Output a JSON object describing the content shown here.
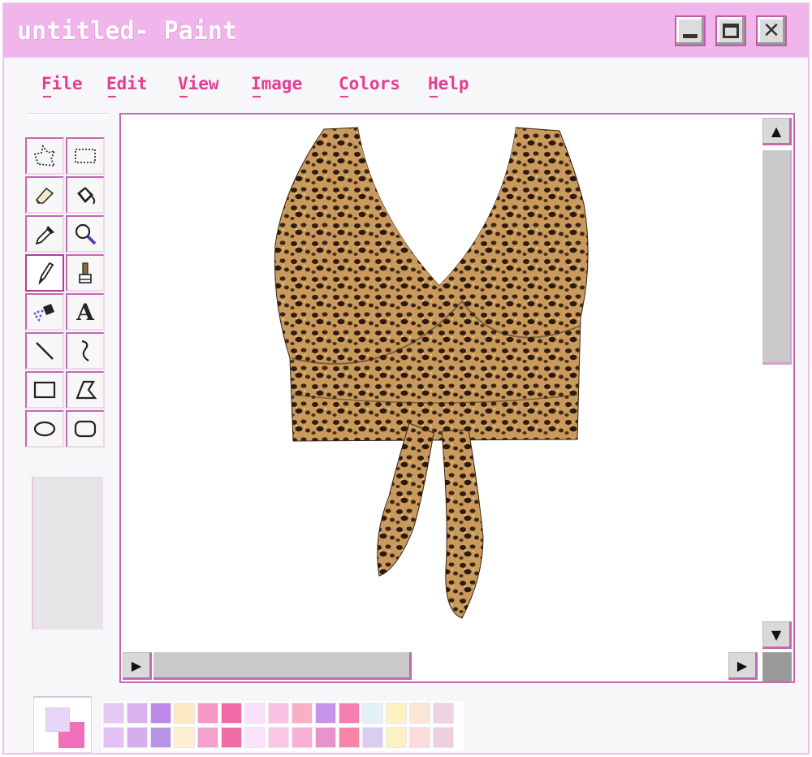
{
  "window": {
    "title": "untitled- Paint",
    "controls": {
      "minimize": "minimize",
      "maximize": "maximize",
      "close": "✕"
    }
  },
  "menu": {
    "items": [
      "File",
      "Edit",
      "View",
      "Image",
      "Colors",
      "Help"
    ]
  },
  "tools": [
    {
      "name": "free-form-select-icon"
    },
    {
      "name": "rectangle-select-icon"
    },
    {
      "name": "eraser-icon"
    },
    {
      "name": "fill-bucket-icon"
    },
    {
      "name": "color-picker-icon"
    },
    {
      "name": "magnifier-icon"
    },
    {
      "name": "pencil-icon",
      "selected": true
    },
    {
      "name": "brush-icon"
    },
    {
      "name": "airbrush-icon"
    },
    {
      "name": "text-icon",
      "label": "A"
    },
    {
      "name": "line-icon"
    },
    {
      "name": "curve-icon"
    },
    {
      "name": "rectangle-icon"
    },
    {
      "name": "polygon-icon"
    },
    {
      "name": "ellipse-icon"
    },
    {
      "name": "rounded-rectangle-icon"
    }
  ],
  "canvas": {
    "image": "leopard print wrap crop top"
  },
  "colors": {
    "foreground": "#e6d6fa",
    "background": "#f06fb8",
    "accent_pink": "#e43d94",
    "window_border": "#c468b4",
    "titlebar": "#f0b6ec",
    "palette_row1": [
      "#e4c9f2",
      "#dcb1f0",
      "#bd89e8",
      "#fbe9c2",
      "#f59ac6",
      "#f06aa8",
      "#fbe0fa",
      "#f9c2e2",
      "#f8b0c4",
      "#c594e8",
      "#f57fb2",
      "#e2f1f6",
      "#fcf1c2",
      "#fbe5d6",
      "#eed2e2"
    ],
    "palette_row2": [
      "#e2c2f4",
      "#d6aef0",
      "#b894e4",
      "#fcefd2",
      "#f4a2cc",
      "#ef6ea8",
      "#fbe3fb",
      "#f8c8e6",
      "#f7b0d4",
      "#e894ca",
      "#f584a6",
      "#d8cef2",
      "#fbf2c4",
      "#fbdcdc",
      "#ecd0e0"
    ]
  },
  "scrollbars": {
    "up": "▲",
    "down": "▼",
    "left": "▶",
    "right": "▶"
  }
}
